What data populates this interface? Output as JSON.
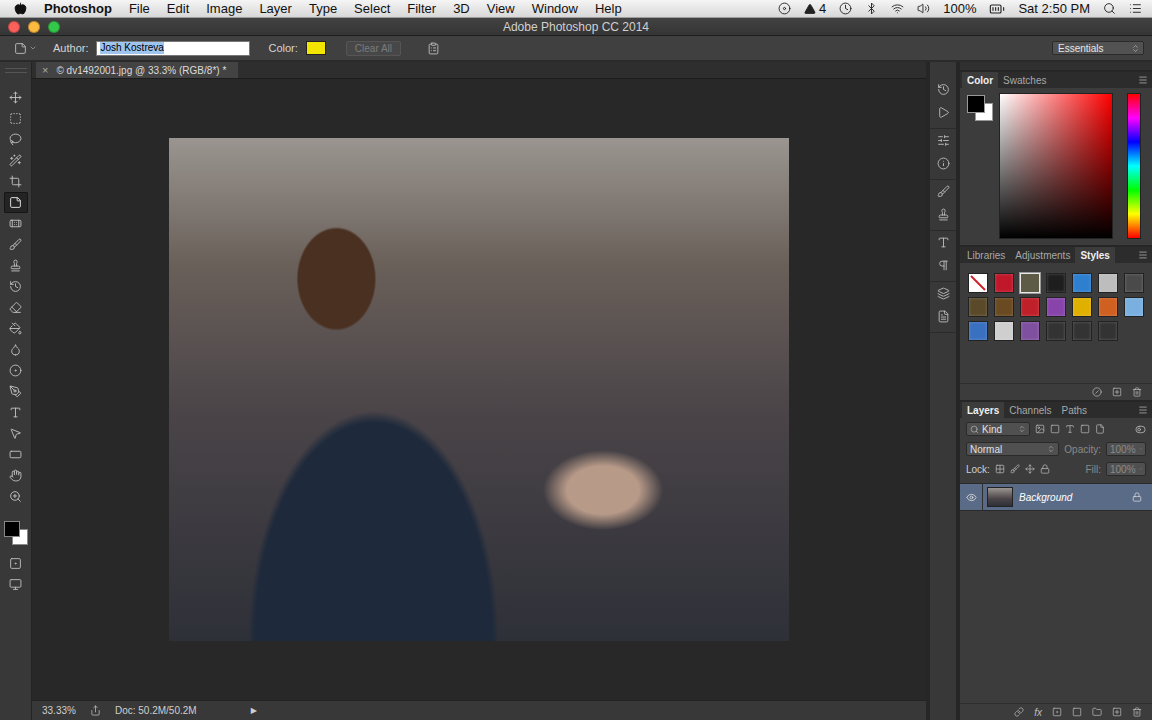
{
  "menu_bar": {
    "app_name": "Photoshop",
    "items": [
      "File",
      "Edit",
      "Image",
      "Layer",
      "Type",
      "Select",
      "Filter",
      "3D",
      "View",
      "Window",
      "Help"
    ],
    "adobe_badge": "4",
    "battery": "100%",
    "clock": "Sat 2:50 PM"
  },
  "window": {
    "title": "Adobe Photoshop CC 2014"
  },
  "options_bar": {
    "author_label": "Author:",
    "author": "Josh Kostreva",
    "author_selected": true,
    "color_label": "Color:",
    "color": "#f2e600",
    "clear_button": {
      "label": "Clear All",
      "disabled": true
    },
    "workspace": "Essentials"
  },
  "document_tab": {
    "close": "×",
    "title": "© dv1492001.jpg @ 33.3% (RGB/8*) *"
  },
  "tools": [
    {
      "kind": "move",
      "selected": false
    },
    {
      "kind": "marquee",
      "selected": false
    },
    {
      "kind": "lasso",
      "selected": false
    },
    {
      "kind": "quick-select",
      "selected": false
    },
    {
      "kind": "crop",
      "selected": false
    },
    {
      "kind": "note",
      "selected": true
    },
    {
      "kind": "healing",
      "selected": false
    },
    {
      "kind": "brush",
      "selected": false
    },
    {
      "kind": "stamp",
      "selected": false
    },
    {
      "kind": "history-brush",
      "selected": false
    },
    {
      "kind": "eraser",
      "selected": false
    },
    {
      "kind": "gradient",
      "selected": false
    },
    {
      "kind": "blur",
      "selected": false
    },
    {
      "kind": "dodge",
      "selected": false
    },
    {
      "kind": "pen",
      "selected": false
    },
    {
      "kind": "type",
      "selected": false
    },
    {
      "kind": "path-select",
      "selected": false
    },
    {
      "kind": "shape",
      "selected": false
    },
    {
      "kind": "hand",
      "selected": false
    },
    {
      "kind": "zoom",
      "selected": false
    }
  ],
  "colors": {
    "foreground": "#000000",
    "background": "#ffffff"
  },
  "color_panel": {
    "tabs": [
      {
        "label": "Color",
        "selected": true
      },
      {
        "label": "Swatches",
        "selected": false
      }
    ]
  },
  "styles_panel": {
    "tabs": [
      {
        "label": "Libraries",
        "selected": false
      },
      {
        "label": "Adjustments",
        "selected": false
      },
      {
        "label": "Styles",
        "selected": true
      }
    ],
    "styles": [
      {
        "kind": "none",
        "color": "#ffffff",
        "selected": false
      },
      {
        "kind": "swatch",
        "color": "#c0182a",
        "selected": false
      },
      {
        "kind": "swatch",
        "color": "#5d5a46",
        "selected": true
      },
      {
        "kind": "swatch",
        "color": "#1e1e1e",
        "selected": false
      },
      {
        "kind": "swatch",
        "color": "#2f7fd0",
        "selected": false
      },
      {
        "kind": "swatch",
        "color": "#bdbdbd",
        "selected": false
      },
      {
        "kind": "swatch",
        "color": "#4a4a4a",
        "selected": false
      },
      {
        "kind": "swatch",
        "color": "#5a4a2a",
        "selected": false
      },
      {
        "kind": "swatch",
        "color": "#6a4a20",
        "selected": false
      },
      {
        "kind": "swatch",
        "color": "#c0202a",
        "selected": false
      },
      {
        "kind": "swatch",
        "color": "#8844aa",
        "selected": false
      },
      {
        "kind": "swatch",
        "color": "#e0b000",
        "selected": false
      },
      {
        "kind": "swatch",
        "color": "#d06020",
        "selected": false
      },
      {
        "kind": "swatch",
        "color": "#7ab0e0",
        "selected": false
      },
      {
        "kind": "swatch",
        "color": "#3a70c0",
        "selected": false
      },
      {
        "kind": "swatch",
        "color": "#cfcfcf",
        "selected": false
      },
      {
        "kind": "swatch",
        "color": "#8050a0",
        "selected": false
      },
      {
        "kind": "swatch",
        "color": "#333333",
        "selected": false
      },
      {
        "kind": "swatch",
        "color": "#333333",
        "selected": false
      },
      {
        "kind": "swatch",
        "color": "#333333",
        "selected": false
      }
    ]
  },
  "layers_panel": {
    "tabs": [
      {
        "label": "Layers",
        "selected": true
      },
      {
        "label": "Channels",
        "selected": false
      },
      {
        "label": "Paths",
        "selected": false
      }
    ],
    "filter": "Kind",
    "blend_mode": "Normal",
    "opacity_label": "Opacity:",
    "opacity": "100%",
    "opacity_disabled": true,
    "lock_label": "Lock:",
    "fill_label": "Fill:",
    "fill": "100%",
    "fill_disabled": true,
    "layers": [
      {
        "name": "Background",
        "visible": true,
        "locked": true,
        "selected": true
      }
    ],
    "footer_fx": "fx"
  },
  "status_bar": {
    "zoom": "33.33%",
    "doc": "Doc: 50.2M/50.2M",
    "menu_arrow": "▶"
  }
}
